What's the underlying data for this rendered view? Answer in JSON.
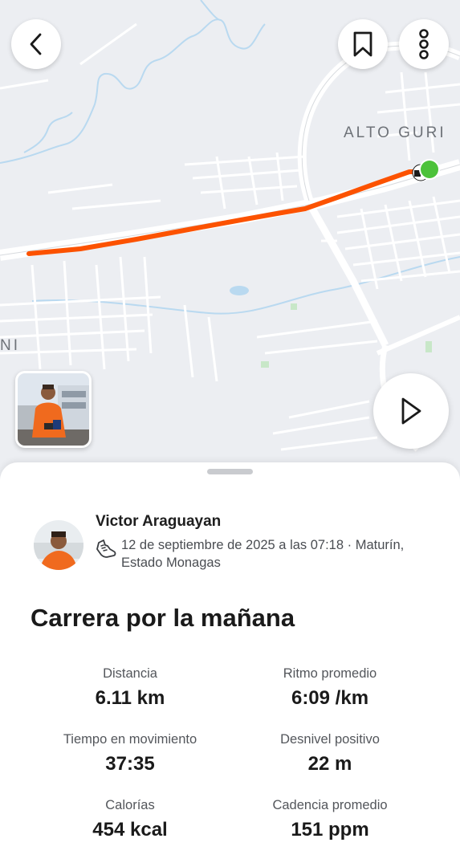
{
  "map": {
    "labels": {
      "neighborhood": "ALTO GURI",
      "edge": "NI"
    }
  },
  "toolbar": {
    "back_icon": "chevron-left-icon",
    "bookmark_icon": "bookmark-icon",
    "more_icon": "vertical-dots-icon",
    "play_icon": "play-icon"
  },
  "colors": {
    "route": "#fc5200",
    "end_marker": "#4cc23a",
    "map_background": "#eceef2"
  },
  "activity": {
    "athlete_name": "Victor Araguayan",
    "activity_type_icon": "running-shoe-icon",
    "meta": "12 de septiembre de 2025 a las 07:18 · Maturín, Estado Monagas",
    "title": "Carrera por la mañana"
  },
  "stats": [
    {
      "label": "Distancia",
      "value": "6.11 km"
    },
    {
      "label": "Ritmo promedio",
      "value": "6:09 /km"
    },
    {
      "label": "Tiempo en movimiento",
      "value": "37:35"
    },
    {
      "label": "Desnivel positivo",
      "value": "22 m"
    },
    {
      "label": "Calorías",
      "value": "454 kcal"
    },
    {
      "label": "Cadencia promedio",
      "value": "151 ppm"
    }
  ]
}
